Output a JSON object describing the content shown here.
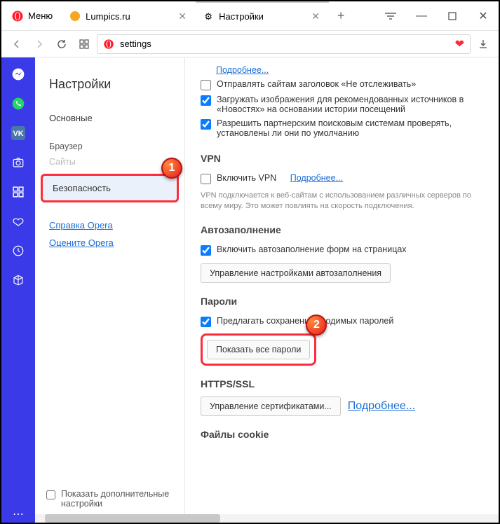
{
  "menu_label": "Меню",
  "tabs": [
    {
      "title": "Lumpics.ru",
      "favicon_color": "#f5a623",
      "active": false
    },
    {
      "title": "Настройки",
      "favicon": "gear",
      "active": true
    }
  ],
  "window_controls": {
    "menu": "≡",
    "min": "—",
    "max": "▢",
    "close": "✕"
  },
  "address": {
    "value": "settings"
  },
  "rail_icons": [
    "messenger",
    "whatsapp",
    "vk",
    "camera",
    "apps",
    "heart",
    "clock",
    "cube",
    "more"
  ],
  "sidebar": {
    "title": "Настройки",
    "items": {
      "basic": "Основные",
      "browser": "Браузер",
      "sites": "Сайты",
      "security": "Безопасность",
      "help": "Справка Opera",
      "rate": "Оцените Opera"
    },
    "show_advanced": "Показать дополнительные настройки"
  },
  "badges": {
    "one": "1",
    "two": "2"
  },
  "main": {
    "more_link": "Подробнее...",
    "priv1": "Отправлять сайтам заголовок «Не отслеживать»",
    "priv2": "Загружать изображения для рекомендованных источников в «Новостях» на основании истории посещений",
    "priv3": "Разрешить партнерским поисковым системам проверять, установлены ли они по умолчанию",
    "vpn_title": "VPN",
    "vpn_enable": "Включить VPN",
    "vpn_more": "Подробнее...",
    "vpn_note": "VPN подключается к веб-сайтам с использованием различных серверов по всему миру. Это может повлиять на скорость подключения.",
    "autofill_title": "Автозаполнение",
    "autofill_enable": "Включить автозаполнение форм на страницах",
    "autofill_btn": "Управление настройками автозаполнения",
    "pwd_title": "Пароли",
    "pwd_offer": "Предлагать сохранение вводимых паролей",
    "pwd_show_all": "Показать все пароли",
    "https_title": "HTTPS/SSL",
    "https_btn": "Управление сертификатами...",
    "https_more": "Подробнее...",
    "cookies_title": "Файлы cookie"
  }
}
